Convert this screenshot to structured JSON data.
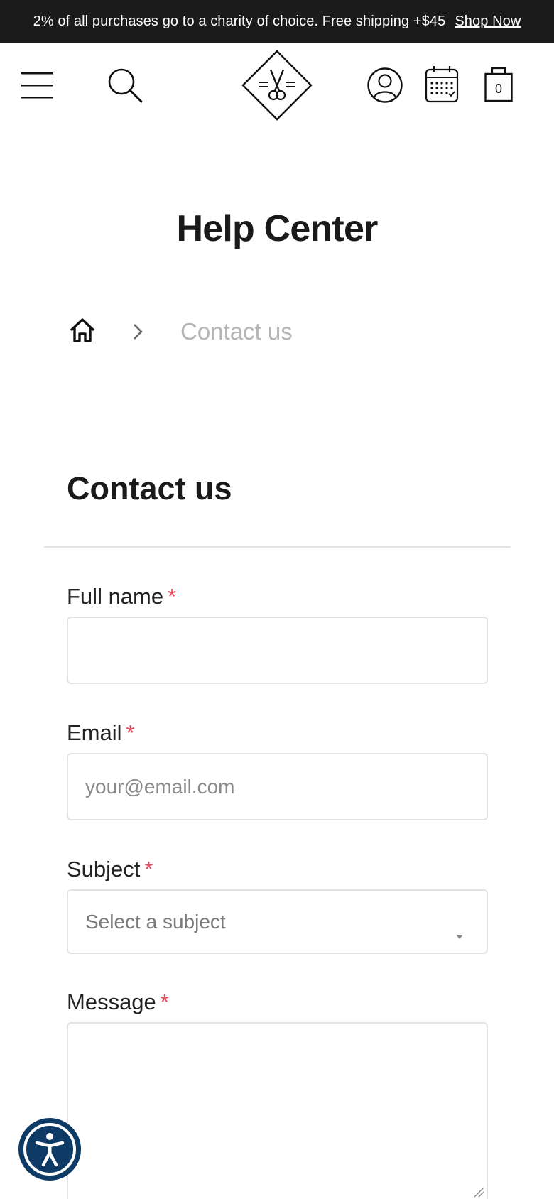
{
  "announcement": {
    "text": "2% of all purchases go to a charity of choice. Free shipping +$45",
    "link_label": "Shop Now"
  },
  "header": {
    "icons": [
      "menu-icon",
      "search-icon",
      "logo-scissors",
      "account-icon",
      "calendar-icon",
      "cart-icon"
    ],
    "cart_count": "0"
  },
  "page": {
    "title": "Help Center"
  },
  "breadcrumb": {
    "current": "Contact us"
  },
  "form": {
    "title": "Contact us",
    "required_mark": "*",
    "full_name": {
      "label": "Full name",
      "value": "",
      "placeholder": ""
    },
    "email": {
      "label": "Email",
      "value": "",
      "placeholder": "your@email.com"
    },
    "subject": {
      "label": "Subject",
      "selected": "Select a subject"
    },
    "message": {
      "label": "Message",
      "value": ""
    }
  },
  "colors": {
    "announcement_bg": "#1b1b1b",
    "required": "#e8445a",
    "accessibility_button": "#0e3a66",
    "breadcrumb_current": "#b5b5b5",
    "field_border": "#e3e3e3"
  }
}
